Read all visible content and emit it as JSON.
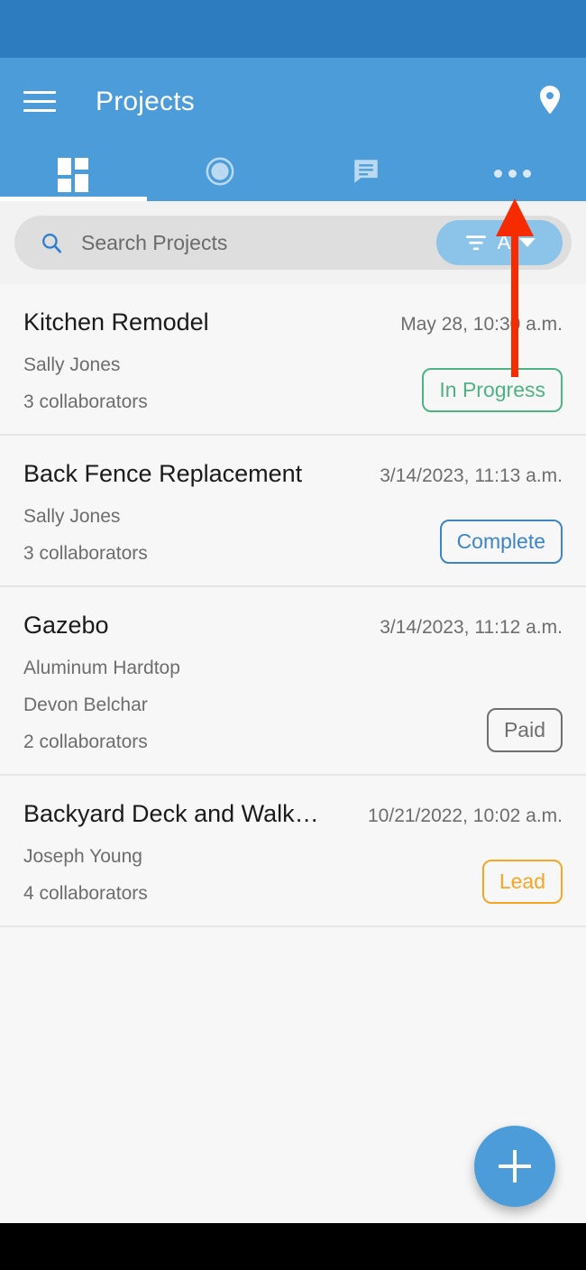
{
  "app": {
    "title": "Projects",
    "status_bar_color": "#2d7cbf",
    "app_bar_color": "#4c9cd9",
    "accent_color": "#4c9cd9"
  },
  "header": {
    "menu_icon": "hamburger-menu-icon",
    "location_icon": "map-pin-icon"
  },
  "tabs": [
    {
      "name": "dashboard",
      "icon": "grid-dashboard-icon",
      "active": true
    },
    {
      "name": "time",
      "icon": "pie-timer-icon",
      "active": false
    },
    {
      "name": "messages",
      "icon": "chat-bubble-icon",
      "active": false
    },
    {
      "name": "more",
      "icon": "overflow-dots-icon",
      "active": false
    }
  ],
  "search": {
    "icon": "search-icon",
    "placeholder": "Search Projects",
    "value": ""
  },
  "filter": {
    "icon": "filter-icon",
    "label": "A",
    "caret_icon": "chevron-down-icon",
    "pill_color": "#8cc3e8"
  },
  "projects": [
    {
      "title": "Kitchen Remodel",
      "date": "May 28, 10:30 a.m.",
      "subtitle": "",
      "owner": "Sally Jones",
      "collaborators": "3 collaborators",
      "status": "In Progress",
      "status_color": "#4fb286"
    },
    {
      "title": "Back Fence Replacement",
      "date": "3/14/2023, 11:13 a.m.",
      "subtitle": "",
      "owner": "Sally Jones",
      "collaborators": "3 collaborators",
      "status": "Complete",
      "status_color": "#3d85c6"
    },
    {
      "title": "Gazebo",
      "date": "3/14/2023, 11:12 a.m.",
      "subtitle": "Aluminum Hardtop",
      "owner": "Devon Belchar",
      "collaborators": "2 collaborators",
      "status": "Paid",
      "status_color": "#6f6f6f"
    },
    {
      "title": "Backyard Deck and Walk…",
      "date": "10/21/2022, 10:02 a.m.",
      "subtitle": "",
      "owner": "Joseph Young",
      "collaborators": "4 collaborators",
      "status": "Lead",
      "status_color": "#f5a623"
    }
  ],
  "fab": {
    "icon": "plus-icon",
    "label": "Add project"
  },
  "annotation": {
    "arrow_color": "#f62b00",
    "points_to": "more-tab"
  }
}
